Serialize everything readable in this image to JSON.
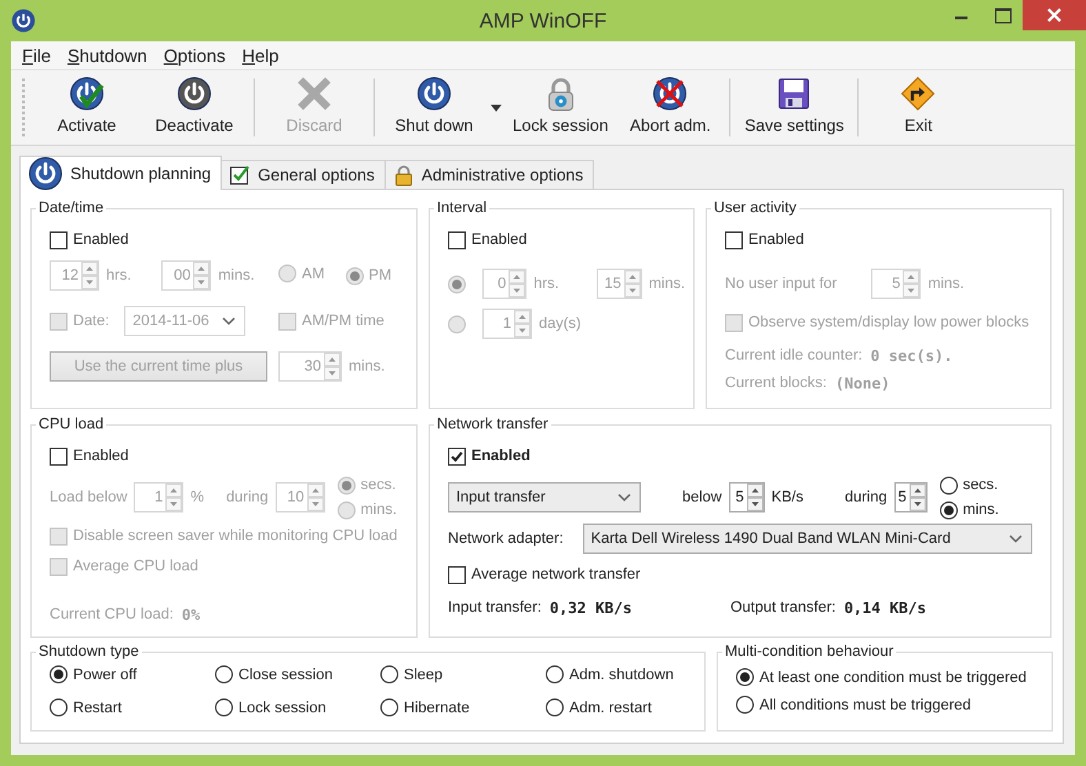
{
  "window": {
    "title": "AMP WinOFF"
  },
  "menu": [
    "File",
    "Shutdown",
    "Options",
    "Help"
  ],
  "toolbar": [
    [
      {
        "label": "Activate",
        "disabled": false
      },
      {
        "label": "Deactivate",
        "disabled": false
      }
    ],
    [
      {
        "label": "Discard",
        "disabled": true
      }
    ],
    [
      {
        "label": "Shut down",
        "disabled": false,
        "dropdown": true
      },
      {
        "label": "Lock session",
        "disabled": false
      },
      {
        "label": "Abort adm.",
        "disabled": false
      }
    ],
    [
      {
        "label": "Save settings",
        "disabled": false
      }
    ],
    [
      {
        "label": "Exit",
        "disabled": false
      }
    ]
  ],
  "tabs": [
    {
      "label": "Shutdown planning",
      "selected": true
    },
    {
      "label": "General options",
      "selected": false
    },
    {
      "label": "Administrative options",
      "selected": false
    }
  ],
  "date_time": {
    "title": "Date/time",
    "enabled": {
      "label": "Enabled",
      "checked": false
    },
    "hours": {
      "value": "12",
      "unit": "hrs."
    },
    "minutes": {
      "value": "00",
      "unit": "mins."
    },
    "ampm": [
      {
        "label": "AM",
        "selected": false
      },
      {
        "label": "PM",
        "selected": true
      }
    ],
    "date": {
      "label": "Date:",
      "checked": false,
      "value": "2014-11-06"
    },
    "ampm_time": {
      "label": "AM/PM time",
      "checked": false
    },
    "plus_button": "Use the current time plus",
    "plus": {
      "value": "30",
      "unit": "mins."
    }
  },
  "interval": {
    "title": "Interval",
    "enabled": {
      "label": "Enabled",
      "checked": false
    },
    "modes": [
      {
        "selected": true,
        "fields": [
          {
            "value": "0",
            "unit": "hrs."
          },
          {
            "value": "15",
            "unit": "mins."
          }
        ]
      },
      {
        "selected": false,
        "fields": [
          {
            "value": "1",
            "unit": "day(s)"
          }
        ]
      }
    ]
  },
  "user_activity": {
    "title": "User activity",
    "enabled": {
      "label": "Enabled",
      "checked": false
    },
    "idle_label": "No user input for",
    "idle": {
      "value": "5",
      "unit": "mins."
    },
    "observe": {
      "label": "Observe system/display low power blocks",
      "checked": false
    },
    "stats": [
      {
        "label": "Current idle counter:",
        "value": "0 sec(s)."
      },
      {
        "label": "Current blocks:",
        "value": "(None)"
      }
    ]
  },
  "cpu_load": {
    "title": "CPU load",
    "enabled": {
      "label": "Enabled",
      "checked": false
    },
    "below_label": "Load below",
    "below": {
      "value": "1",
      "unit": "%"
    },
    "during_label": "during",
    "during": {
      "value": "10"
    },
    "units": [
      {
        "label": "secs.",
        "selected": true
      },
      {
        "label": "mins.",
        "selected": false
      }
    ],
    "options": [
      {
        "label": "Disable screen saver while monitoring CPU load",
        "checked": false
      },
      {
        "label": "Average CPU load",
        "checked": false
      }
    ],
    "stats": [
      {
        "label": "Current CPU load:",
        "value": "0%"
      }
    ]
  },
  "network_transfer": {
    "title": "Network transfer",
    "enabled": {
      "label": "Enabled",
      "checked": true
    },
    "direction": "Input transfer",
    "below_label": "below",
    "below": {
      "value": "5",
      "unit": "KB/s"
    },
    "during_label": "during",
    "during": {
      "value": "5"
    },
    "units": [
      {
        "label": "secs.",
        "selected": false
      },
      {
        "label": "mins.",
        "selected": true
      }
    ],
    "adapter_label": "Network adapter:",
    "adapter": "Karta Dell Wireless 1490 Dual Band WLAN Mini-Card",
    "options": [
      {
        "label": "Average network transfer",
        "checked": false
      }
    ],
    "stats": [
      {
        "label": "Input transfer:",
        "value": "0,32 KB/s"
      },
      {
        "label": "Output transfer:",
        "value": "0,14 KB/s"
      }
    ]
  },
  "shutdown_type": {
    "title": "Shutdown type",
    "options": [
      {
        "label": "Power off",
        "selected": true
      },
      {
        "label": "Close session",
        "selected": false
      },
      {
        "label": "Sleep",
        "selected": false
      },
      {
        "label": "Adm. shutdown",
        "selected": false
      },
      {
        "label": "Restart",
        "selected": false
      },
      {
        "label": "Lock session",
        "selected": false
      },
      {
        "label": "Hibernate",
        "selected": false
      },
      {
        "label": "Adm. restart",
        "selected": false
      }
    ]
  },
  "multi_condition": {
    "title": "Multi-condition behaviour",
    "options": [
      {
        "label": "At least one condition must be triggered",
        "selected": true
      },
      {
        "label": "All conditions must be triggered",
        "selected": false
      }
    ]
  }
}
